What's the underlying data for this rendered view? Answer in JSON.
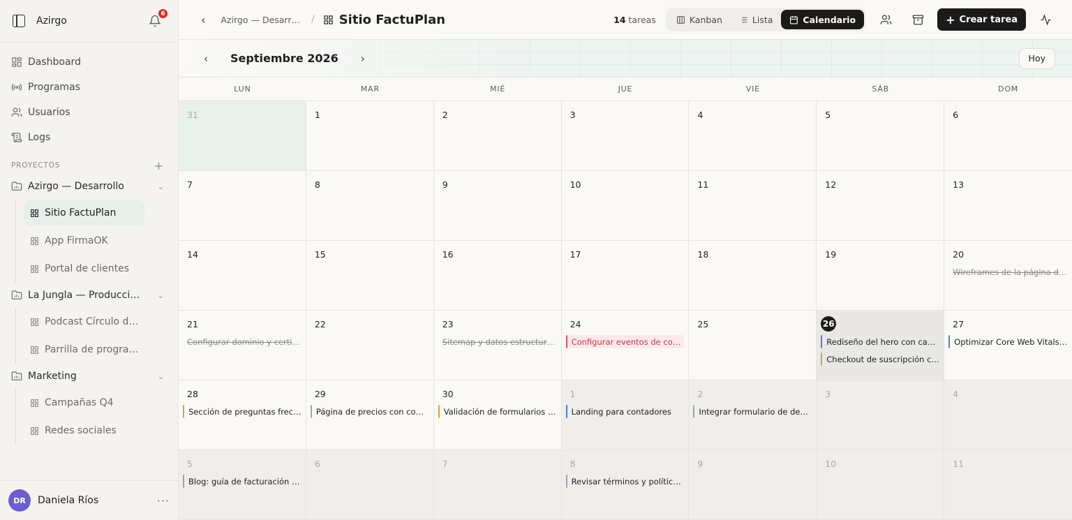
{
  "workspace": "Azirgo",
  "notifications": "6",
  "nav": [
    {
      "label": "Dashboard",
      "icon": "grid-icon"
    },
    {
      "label": "Programas",
      "icon": "broadcast-icon"
    },
    {
      "label": "Usuarios",
      "icon": "users-icon"
    },
    {
      "label": "Logs",
      "icon": "scroll-icon"
    }
  ],
  "projects_label": "PROYECTOS",
  "projects": [
    {
      "name": "Azirgo — Desarrollo",
      "children": [
        "Sitio FactuPlan",
        "App FirmaOK",
        "Portal de clientes"
      ]
    },
    {
      "name": "La Jungla — Producci…",
      "children": [
        "Podcast Círculo de …",
        "Parrilla de program…"
      ]
    },
    {
      "name": "Marketing",
      "children": [
        "Campañas Q4",
        "Redes sociales"
      ]
    }
  ],
  "user": {
    "initials": "DR",
    "name": "Daniela Ríos",
    "more": "···"
  },
  "topbar": {
    "breadcrumb": "Azirgo — Desarr…",
    "title": "Sitio FactuPlan",
    "count_num": "14",
    "count_label": "tareas",
    "views": [
      "Kanban",
      "Lista",
      "Calendario"
    ],
    "create_label": "Crear tarea"
  },
  "calendar": {
    "month": "Septiembre 2026",
    "today_label": "Hoy",
    "weekdays": [
      "LUN",
      "MAR",
      "MIÉ",
      "JUE",
      "VIE",
      "SÁB",
      "DOM"
    ],
    "days": [
      {
        "d": "31",
        "out": true,
        "first": true
      },
      {
        "d": "1"
      },
      {
        "d": "2"
      },
      {
        "d": "3"
      },
      {
        "d": "4"
      },
      {
        "d": "5"
      },
      {
        "d": "6"
      },
      {
        "d": "7"
      },
      {
        "d": "8"
      },
      {
        "d": "9"
      },
      {
        "d": "10"
      },
      {
        "d": "11"
      },
      {
        "d": "12"
      },
      {
        "d": "13"
      },
      {
        "d": "14"
      },
      {
        "d": "15"
      },
      {
        "d": "16"
      },
      {
        "d": "17"
      },
      {
        "d": "18"
      },
      {
        "d": "19"
      },
      {
        "d": "20",
        "tasks": [
          {
            "t": "Wireframes de la página de i…",
            "s": "done"
          }
        ]
      },
      {
        "d": "21",
        "tasks": [
          {
            "t": "Configurar dominio y certific…",
            "s": "done"
          }
        ]
      },
      {
        "d": "22"
      },
      {
        "d": "23",
        "tasks": [
          {
            "t": "Sitemap y datos estructurad…",
            "s": "done"
          }
        ]
      },
      {
        "d": "24",
        "tasks": [
          {
            "t": "Configurar eventos de conve…",
            "s": "red"
          }
        ]
      },
      {
        "d": "25"
      },
      {
        "d": "26",
        "today": true,
        "tasks": [
          {
            "t": "Rediseño del hero con captu…",
            "s": "blue"
          },
          {
            "t": "Checkout de suscripción co…",
            "s": "orange"
          }
        ]
      },
      {
        "d": "27",
        "tasks": [
          {
            "t": "Optimizar Core Web Vitals e…",
            "s": "blue"
          }
        ]
      },
      {
        "d": "28",
        "tasks": [
          {
            "t": "Sección de preguntas frecu…",
            "s": "orange"
          }
        ]
      },
      {
        "d": "29",
        "tasks": [
          {
            "t": "Página de precios con comp…",
            "s": "grey"
          }
        ]
      },
      {
        "d": "30",
        "tasks": [
          {
            "t": "Validación de formularios en…",
            "s": "orange"
          }
        ]
      },
      {
        "d": "1",
        "out": true,
        "tasks": [
          {
            "t": "Landing para contadores",
            "s": "blue"
          }
        ]
      },
      {
        "d": "2",
        "out": true,
        "tasks": [
          {
            "t": "Integrar formulario de demo …",
            "s": "grey"
          }
        ]
      },
      {
        "d": "3",
        "out": true
      },
      {
        "d": "4",
        "out": true
      },
      {
        "d": "5",
        "out": true,
        "tasks": [
          {
            "t": "Blog: guía de facturación ele…",
            "s": "grey"
          }
        ]
      },
      {
        "d": "6",
        "out": true
      },
      {
        "d": "7",
        "out": true
      },
      {
        "d": "8",
        "out": true,
        "tasks": [
          {
            "t": "Revisar términos y política d…",
            "s": "grey"
          }
        ]
      },
      {
        "d": "9",
        "out": true
      },
      {
        "d": "10",
        "out": true
      },
      {
        "d": "11",
        "out": true
      }
    ]
  }
}
